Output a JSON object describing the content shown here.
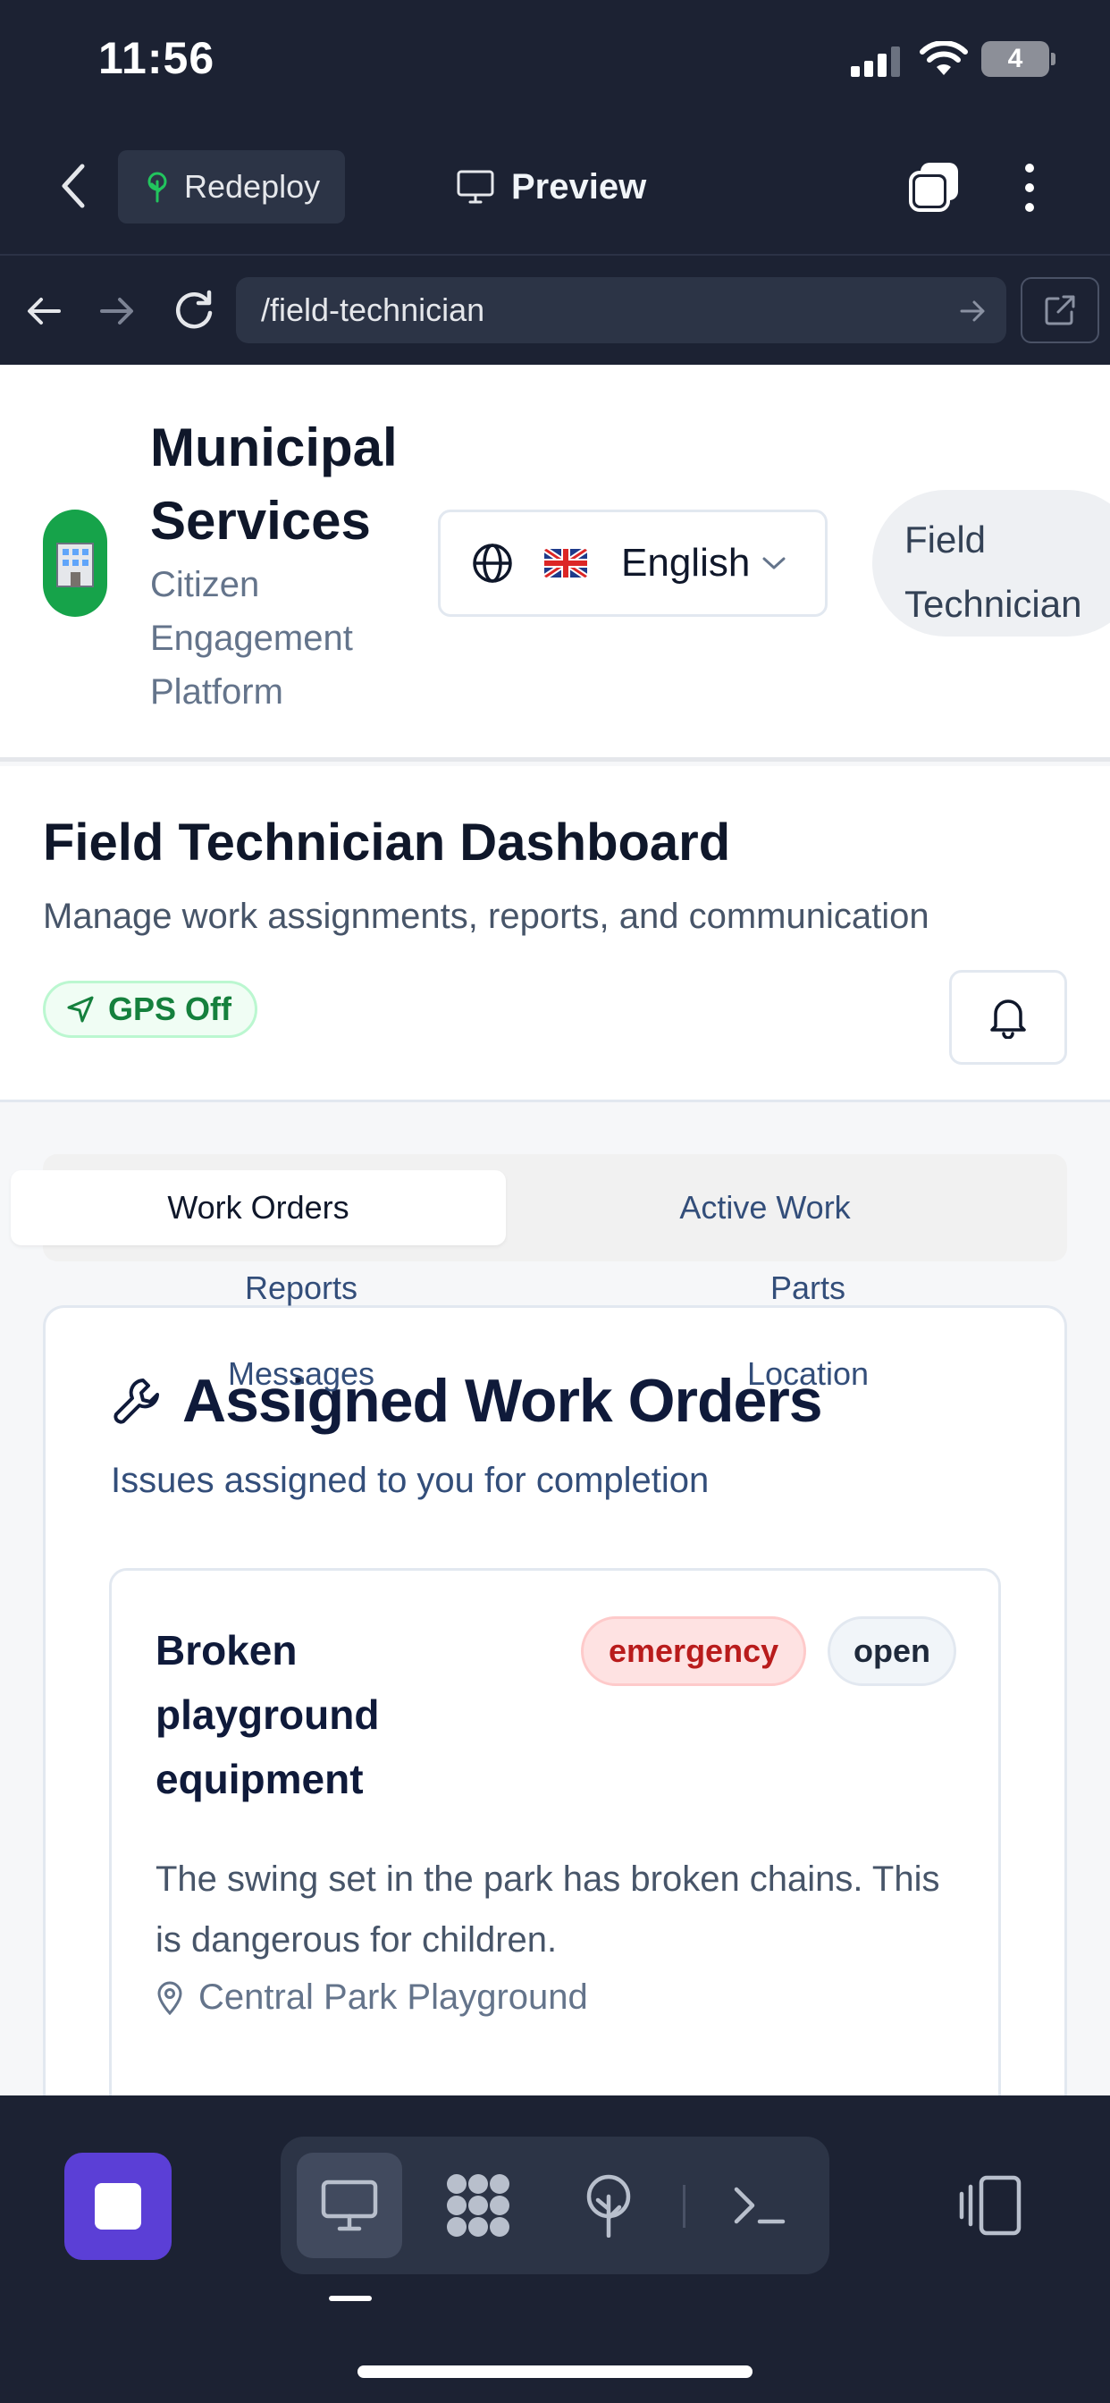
{
  "status_bar": {
    "time": "11:56",
    "battery": "4"
  },
  "toolbar": {
    "redeploy_label": "Redeploy",
    "preview_label": "Preview"
  },
  "browser": {
    "url": "/field-technician"
  },
  "header": {
    "brand_title": "Municipal Services",
    "brand_subtitle": "Citizen Engagement Platform",
    "language": "English",
    "role": "Field Technician"
  },
  "dashboard": {
    "title": "Field Technician Dashboard",
    "subtitle": "Manage work assignments, reports, and communication",
    "gps_status": "GPS Off"
  },
  "tabs": {
    "work_orders": "Work Orders",
    "active_work": "Active Work",
    "reports": "Reports",
    "parts": "Parts",
    "messages": "Messages",
    "location": "Location"
  },
  "work_orders_card": {
    "title": "Assigned Work Orders",
    "subtitle": "Issues assigned to you for completion",
    "orders": [
      {
        "title": "Broken playground equipment",
        "priority": "emergency",
        "status": "open",
        "description": "The swing set in the park has broken chains. This is dangerous for children.",
        "location": "Central Park Playground"
      }
    ]
  },
  "colors": {
    "chrome_bg": "#1c2233",
    "accent_purple": "#5b3fd6",
    "emergency": "#b91c1c",
    "gps_green": "#15803d"
  },
  "icons": {
    "dock": [
      "desktop-icon",
      "grid-icon",
      "deploy-icon",
      "terminal-icon"
    ],
    "device_toggle": "device-icon"
  }
}
